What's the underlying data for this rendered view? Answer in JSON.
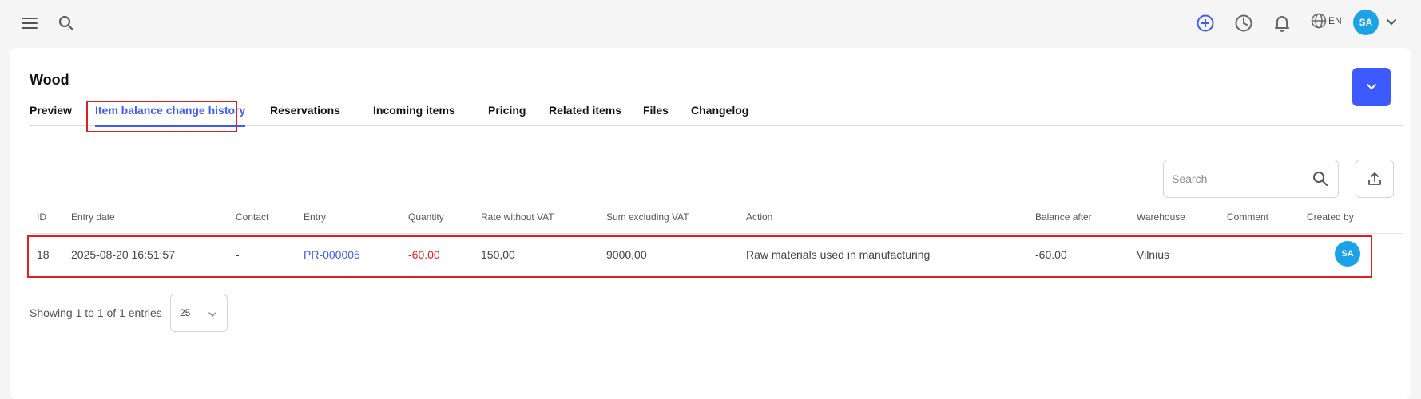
{
  "topbar": {
    "language": "EN",
    "user_initials": "SA",
    "icons": [
      "menu-icon",
      "search-icon",
      "add-circle-icon",
      "clock-icon",
      "bell-icon",
      "globe-icon",
      "chevron-down-icon"
    ],
    "accent_color": "#3d5afe"
  },
  "page": {
    "title": "Wood"
  },
  "tabs": [
    {
      "label": "Preview"
    },
    {
      "label": "Item balance change history",
      "active": true
    },
    {
      "label": "Reservations"
    },
    {
      "label": "Incoming items"
    },
    {
      "label": "Pricing"
    },
    {
      "label": "Related items"
    },
    {
      "label": "Files"
    },
    {
      "label": "Changelog"
    }
  ],
  "search": {
    "placeholder": "Search",
    "value": ""
  },
  "table": {
    "columns": [
      "ID",
      "Entry date",
      "Contact",
      "Entry",
      "Quantity",
      "Rate without VAT",
      "Sum excluding VAT",
      "Action",
      "Balance after",
      "Warehouse",
      "Comment",
      "Created by"
    ],
    "rows": [
      {
        "id": "18",
        "entry_date": "2025-08-20 16:51:57",
        "contact": "-",
        "entry": "PR-000005",
        "quantity": "-60.00",
        "rate": "150,00",
        "sum": "9000,00",
        "action": "Raw materials used in manufacturing",
        "balance_after": "-60.00",
        "warehouse": "Vilnius",
        "comment": "",
        "created_by": "SA"
      }
    ]
  },
  "footer": {
    "info": "Showing 1 to 1 of 1 entries",
    "page_size": "25"
  },
  "colors": {
    "highlight": "#e02020",
    "negative": "#e02020",
    "avatar": "#1aa3e8",
    "link": "#3d5afe"
  }
}
